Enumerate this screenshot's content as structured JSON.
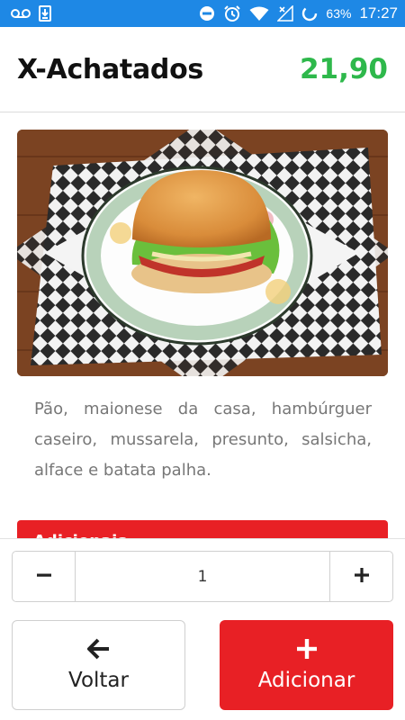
{
  "status_bar": {
    "battery_percent": "63%",
    "time": "17:27",
    "icons": [
      "voicemail-icon",
      "download-icon",
      "do-not-disturb-icon",
      "alarm-icon",
      "wifi-icon",
      "no-signal-icon",
      "battery-icon"
    ]
  },
  "product": {
    "name": "X-Achatados",
    "price": "21,90",
    "price_color": "#2eb84b",
    "image": "burger-photo",
    "description": "Pão, maionese da casa, hambúrguer caseiro, mussarela, presunto, salsicha, alface e batata palha."
  },
  "addons_section": {
    "title": "Adicionais",
    "accent_color": "#e82025"
  },
  "quantity": {
    "value": "1",
    "decrement_icon": "minus-icon",
    "increment_icon": "plus-icon"
  },
  "actions": {
    "back_label": "Voltar",
    "back_icon": "arrow-left-icon",
    "add_label": "Adicionar",
    "add_icon": "plus-icon",
    "add_color": "#e82025"
  }
}
